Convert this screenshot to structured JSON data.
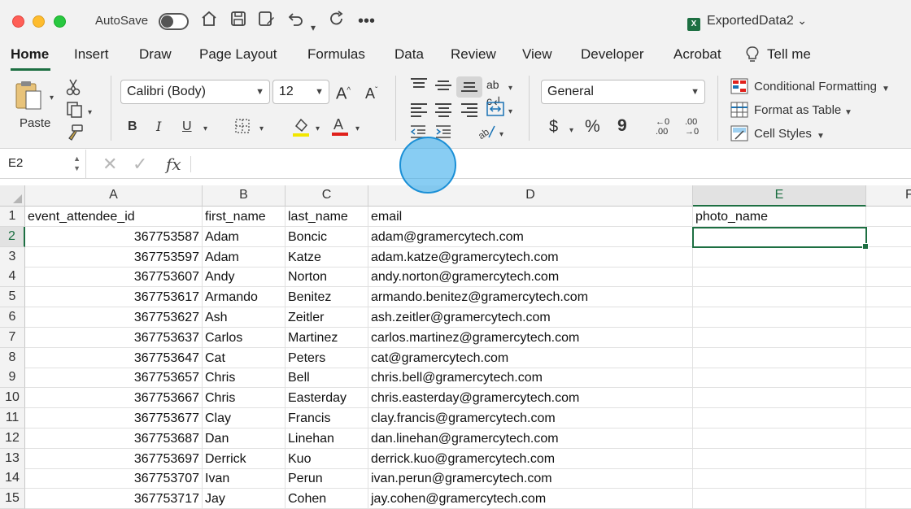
{
  "titlebar": {
    "autosave_label": "AutoSave",
    "document_title": "ExportedData2",
    "document_icon": "X",
    "title_chevron": "⌄",
    "icons": [
      "home-icon",
      "save-icon",
      "save-as-icon",
      "undo-icon",
      "redo-icon",
      "more-icon"
    ]
  },
  "tabs": [
    "Home",
    "Insert",
    "Draw",
    "Page Layout",
    "Formulas",
    "Data",
    "Review",
    "View",
    "Developer",
    "Acrobat",
    "Tell me"
  ],
  "ribbon": {
    "paste_label": "Paste",
    "font_name": "Calibri (Body)",
    "font_size": "12",
    "grow_font": "A^",
    "shrink_font": "A˅",
    "bold": "B",
    "italic": "I",
    "underline": "U",
    "number_format": "General",
    "currency": "$",
    "percent": "%",
    "comma": "9",
    "increase_decimal": "←0 .00",
    "decrease_decimal": ".00 →0",
    "conditional_formatting": "Conditional Formatting",
    "format_as_table": "Format as Table",
    "cell_styles": "Cell Styles",
    "colors": {
      "highlight": "#f2e600",
      "font_color": "#e0201b",
      "accent": "#1d6f42"
    }
  },
  "formula_bar": {
    "name_box": "E2",
    "cancel_icon": "✕",
    "enter_icon": "✓",
    "fx_label": "fx",
    "value": ""
  },
  "grid": {
    "columns": [
      "A",
      "B",
      "C",
      "D",
      "E",
      "F"
    ],
    "selected_cell": "E2",
    "rows": [
      {
        "n": "1",
        "a": "event_attendee_id",
        "b": "first_name",
        "c": "last_name",
        "d": "email",
        "e": "photo_name"
      },
      {
        "n": "2",
        "a": "367753587",
        "b": "Adam",
        "c": "Boncic",
        "d": "adam@gramercytech.com",
        "e": ""
      },
      {
        "n": "3",
        "a": "367753597",
        "b": "Adam",
        "c": "Katze",
        "d": "adam.katze@gramercytech.com",
        "e": ""
      },
      {
        "n": "4",
        "a": "367753607",
        "b": "Andy",
        "c": "Norton",
        "d": "andy.norton@gramercytech.com",
        "e": ""
      },
      {
        "n": "5",
        "a": "367753617",
        "b": "Armando",
        "c": "Benitez",
        "d": "armando.benitez@gramercytech.com",
        "e": ""
      },
      {
        "n": "6",
        "a": "367753627",
        "b": "Ash",
        "c": "Zeitler",
        "d": "ash.zeitler@gramercytech.com",
        "e": ""
      },
      {
        "n": "7",
        "a": "367753637",
        "b": "Carlos",
        "c": "Martinez",
        "d": "carlos.martinez@gramercytech.com",
        "e": ""
      },
      {
        "n": "8",
        "a": "367753647",
        "b": "Cat",
        "c": "Peters",
        "d": "cat@gramercytech.com",
        "e": ""
      },
      {
        "n": "9",
        "a": "367753657",
        "b": "Chris",
        "c": "Bell",
        "d": "chris.bell@gramercytech.com",
        "e": ""
      },
      {
        "n": "10",
        "a": "367753667",
        "b": "Chris",
        "c": "Easterday",
        "d": "chris.easterday@gramercytech.com",
        "e": ""
      },
      {
        "n": "11",
        "a": "367753677",
        "b": "Clay",
        "c": "Francis",
        "d": "clay.francis@gramercytech.com",
        "e": ""
      },
      {
        "n": "12",
        "a": "367753687",
        "b": "Dan",
        "c": "Linehan",
        "d": "dan.linehan@gramercytech.com",
        "e": ""
      },
      {
        "n": "13",
        "a": "367753697",
        "b": "Derrick",
        "c": "Kuo",
        "d": "derrick.kuo@gramercytech.com",
        "e": ""
      },
      {
        "n": "14",
        "a": "367753707",
        "b": "Ivan",
        "c": "Perun",
        "d": "ivan.perun@gramercytech.com",
        "e": ""
      },
      {
        "n": "15",
        "a": "367753717",
        "b": "Jay",
        "c": "Cohen",
        "d": "jay.cohen@gramercytech.com",
        "e": ""
      }
    ]
  }
}
